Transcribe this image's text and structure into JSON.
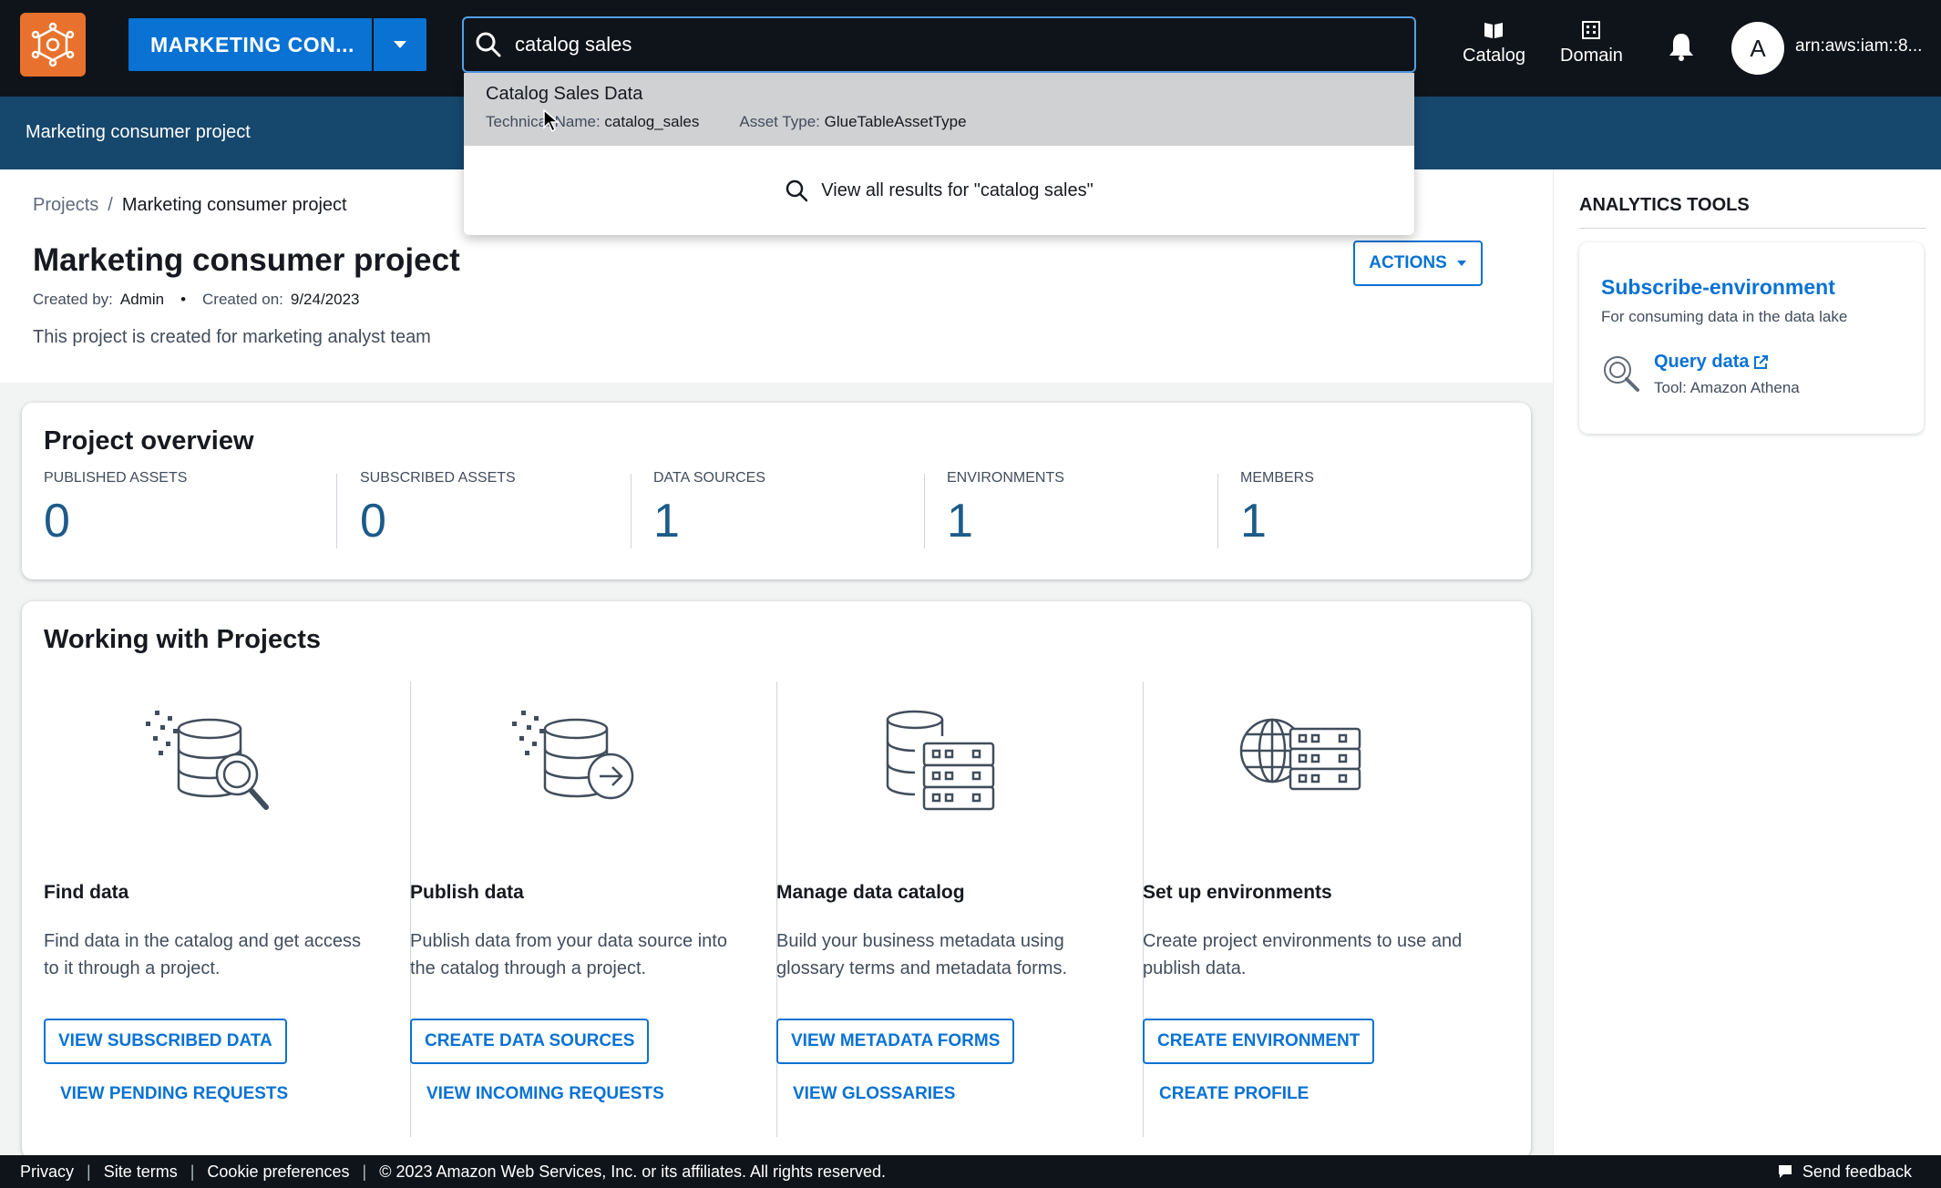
{
  "topbar": {
    "project_selector": "MARKETING CON...",
    "search_value": "catalog sales",
    "nav": [
      {
        "label": "Catalog",
        "icon": "book-icon"
      },
      {
        "label": "Domain",
        "icon": "building-icon"
      }
    ],
    "avatar_letter": "A",
    "account": "arn:aws:iam::8..."
  },
  "band": {
    "title": "Marketing consumer project"
  },
  "search_dropdown": {
    "result": {
      "title": "Catalog Sales Data",
      "technical_label": "Technical Name:",
      "technical_value": "catalog_sales",
      "asset_type_label": "Asset Type:",
      "asset_type_value": "GlueTableAssetType"
    },
    "view_all": "View all results for \"catalog sales\""
  },
  "breadcrumb": {
    "root": "Projects",
    "separator": "/",
    "current": "Marketing consumer project"
  },
  "project": {
    "title": "Marketing consumer project",
    "created_by_label": "Created by:",
    "created_by": "Admin",
    "bullet": "•",
    "created_on_label": "Created on:",
    "created_on": "9/24/2023",
    "description": "This project is created for marketing analyst team",
    "actions_label": "ACTIONS"
  },
  "overview": {
    "title": "Project overview",
    "stats": [
      {
        "label": "PUBLISHED ASSETS",
        "value": "0"
      },
      {
        "label": "SUBSCRIBED ASSETS",
        "value": "0"
      },
      {
        "label": "DATA SOURCES",
        "value": "1"
      },
      {
        "label": "ENVIRONMENTS",
        "value": "1"
      },
      {
        "label": "MEMBERS",
        "value": "1"
      }
    ]
  },
  "working": {
    "title": "Working with Projects",
    "columns": [
      {
        "heading": "Find data",
        "text": "Find data in the catalog and get access to it through a project.",
        "primary": "VIEW SUBSCRIBED DATA",
        "secondary": "VIEW PENDING REQUESTS"
      },
      {
        "heading": "Publish data",
        "text": "Publish data from your data source into the catalog through a project.",
        "primary": "CREATE DATA SOURCES",
        "secondary": "VIEW INCOMING REQUESTS"
      },
      {
        "heading": "Manage data catalog",
        "text": "Build your business metadata using glossary terms and metadata forms.",
        "primary": "VIEW METADATA FORMS",
        "secondary": "VIEW GLOSSARIES"
      },
      {
        "heading": "Set up environments",
        "text": "Create project environments to use and publish data.",
        "primary": "CREATE ENVIRONMENT",
        "secondary": "CREATE PROFILE"
      }
    ]
  },
  "analytics": {
    "title": "ANALYTICS TOOLS",
    "env_name": "Subscribe-environment",
    "env_desc": "For consuming data in the data lake",
    "query_link": "Query data",
    "query_tool": "Tool: Amazon Athena"
  },
  "footer": {
    "links": [
      "Privacy",
      "Site terms",
      "Cookie preferences"
    ],
    "copyright": "© 2023 Amazon Web Services, Inc. or its affiliates. All rights reserved.",
    "feedback": "Send feedback"
  },
  "colors": {
    "topbar": "#0f141a",
    "band": "#16476d",
    "accent": "#0972d3",
    "stat_value": "#1d5b89",
    "logo": "#e8722d"
  }
}
